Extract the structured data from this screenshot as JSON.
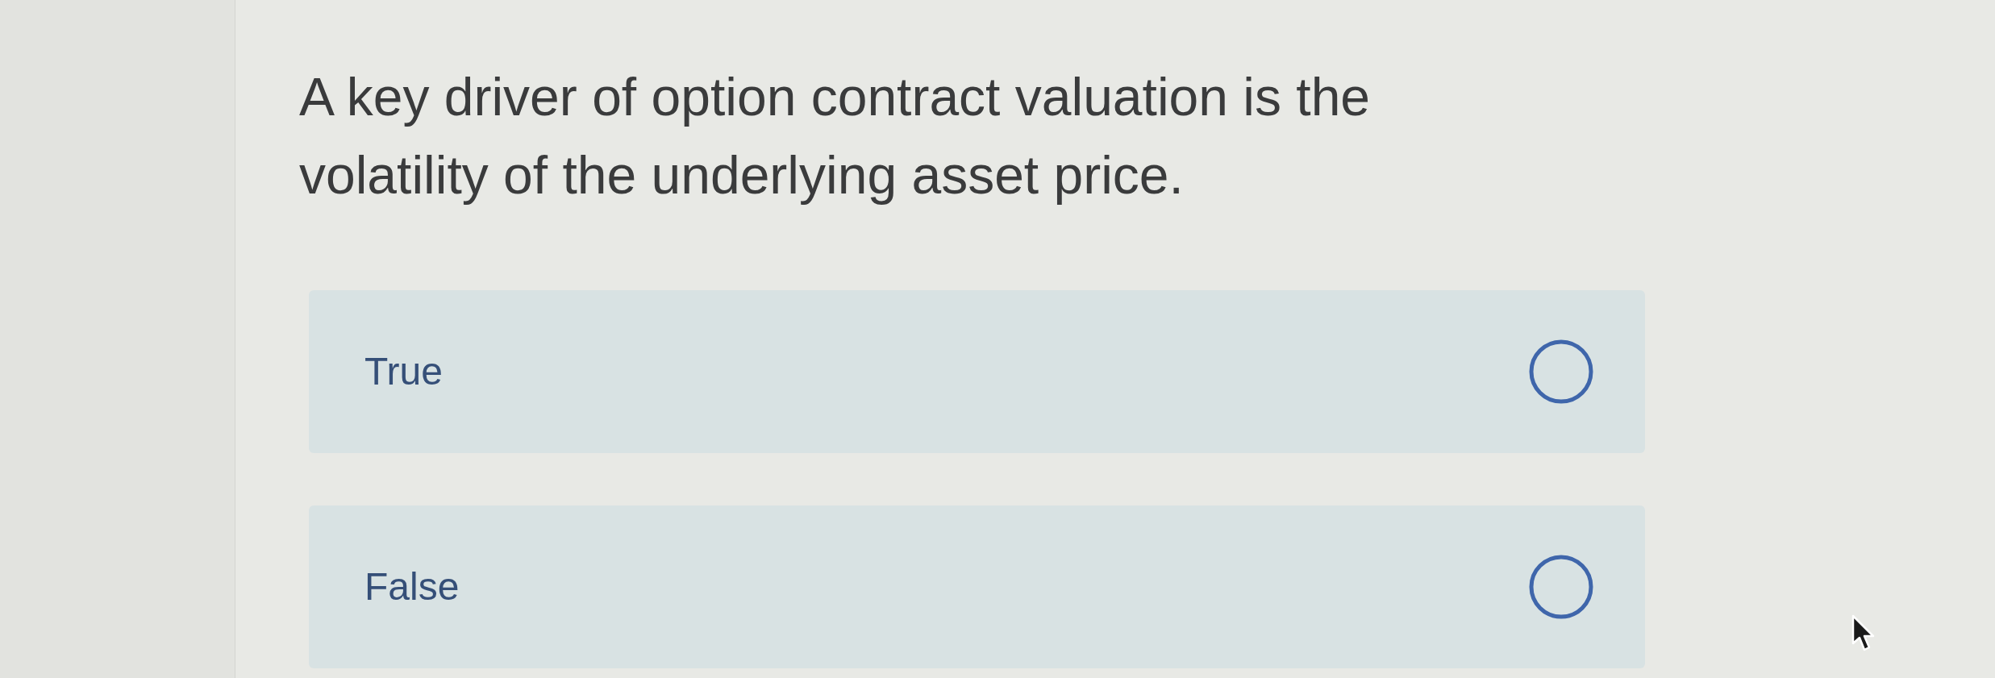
{
  "question": {
    "text": "A key driver of option contract valuation is the volatility of the underlying asset price."
  },
  "options": [
    {
      "label": "True",
      "selected": false
    },
    {
      "label": "False",
      "selected": false
    }
  ]
}
